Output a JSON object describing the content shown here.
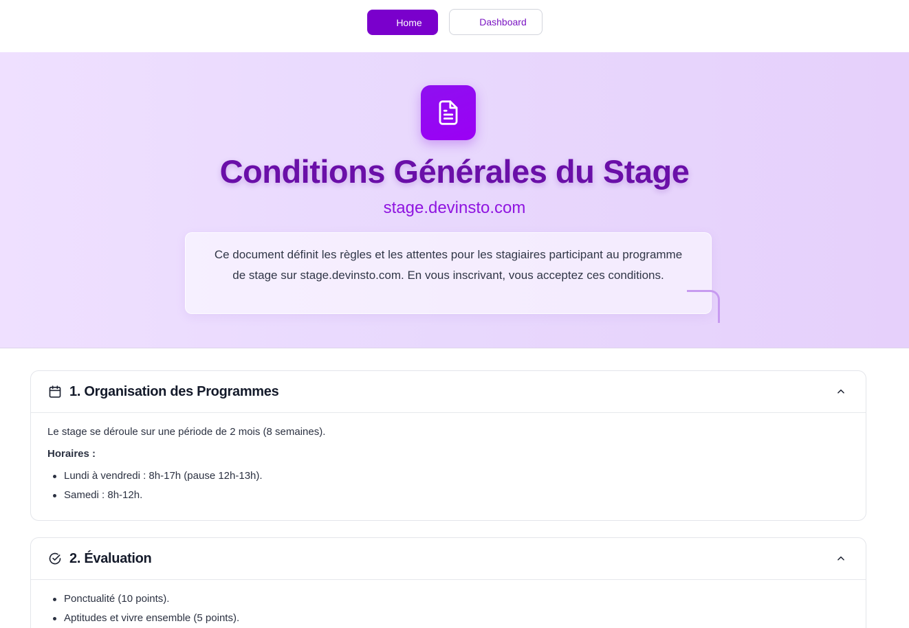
{
  "nav": {
    "home_label": "Home",
    "dashboard_label": "Dashboard"
  },
  "hero": {
    "icon": "document-icon",
    "title": "Conditions Générales du Stage",
    "subtitle": "stage.devinsto.com",
    "intro": "Ce document définit les règles et les attentes pour les stagiaires participant au programme de stage sur stage.devinsto.com. En vous inscrivant, vous acceptez ces conditions."
  },
  "sections": [
    {
      "icon": "calendar-icon",
      "title": "1. Organisation des Programmes",
      "intro": "Le stage se déroule sur une période de 2 mois (8 semaines).",
      "label": "Horaires :",
      "items": [
        "Lundi à vendredi : 8h-17h (pause 12h-13h).",
        "Samedi : 8h-12h."
      ]
    },
    {
      "icon": "check-circle-icon",
      "title": "2. Évaluation",
      "items": [
        "Ponctualité (10 points).",
        "Aptitudes et vivre ensemble (5 points)."
      ]
    }
  ],
  "colors": {
    "brand": "#7a00cc",
    "title": "#6a0fa8",
    "subtitle": "#8f14e0",
    "hero_bg": "#e8d8fd"
  }
}
